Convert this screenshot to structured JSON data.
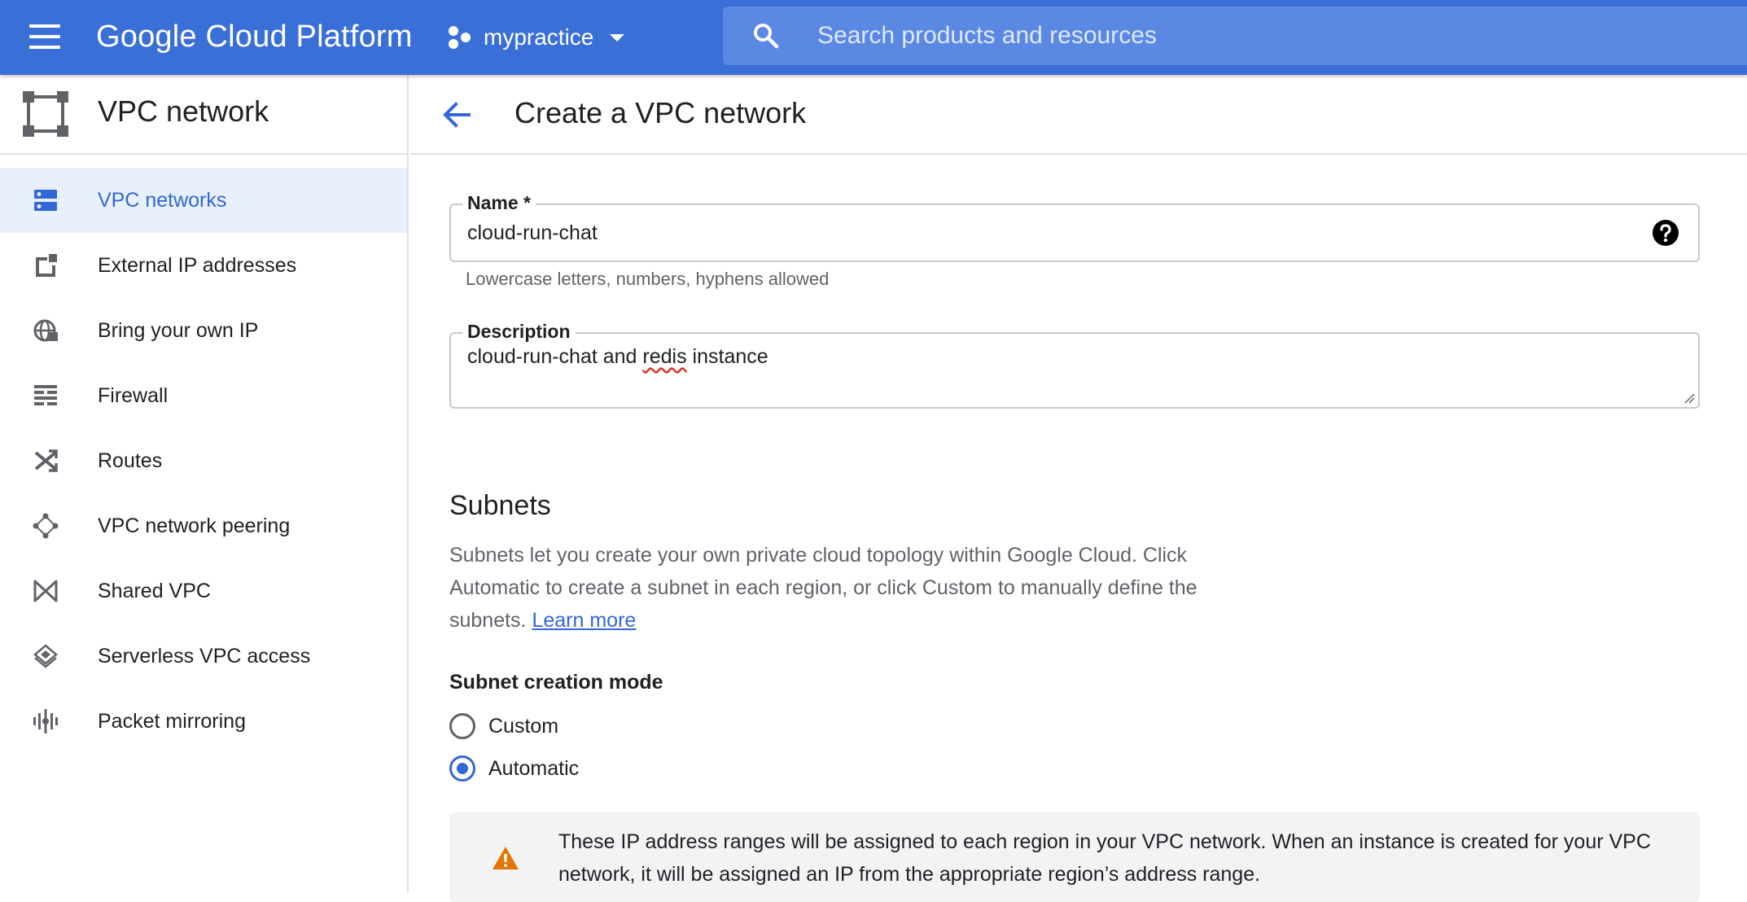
{
  "topbar": {
    "brand": "Google Cloud Platform",
    "project": "mypractice",
    "search_placeholder": "Search products and resources"
  },
  "sidebar": {
    "product_title": "VPC network",
    "items": [
      {
        "label": "VPC networks",
        "icon": "vpc-networks-icon",
        "active": true
      },
      {
        "label": "External IP addresses",
        "icon": "external-ip-icon",
        "active": false
      },
      {
        "label": "Bring your own IP",
        "icon": "globe-icon",
        "active": false
      },
      {
        "label": "Firewall",
        "icon": "firewall-icon",
        "active": false
      },
      {
        "label": "Routes",
        "icon": "routes-icon",
        "active": false
      },
      {
        "label": "VPC network peering",
        "icon": "peering-icon",
        "active": false
      },
      {
        "label": "Shared VPC",
        "icon": "shared-vpc-icon",
        "active": false
      },
      {
        "label": "Serverless VPC access",
        "icon": "serverless-icon",
        "active": false
      },
      {
        "label": "Packet mirroring",
        "icon": "packet-mirroring-icon",
        "active": false
      }
    ]
  },
  "page": {
    "title": "Create a VPC network",
    "name_field": {
      "label": "Name *",
      "value": "cloud-run-chat",
      "hint": "Lowercase letters, numbers, hyphens allowed"
    },
    "description_field": {
      "label": "Description",
      "value_before": "cloud-run-chat and ",
      "value_flagged": "redis",
      "value_after": " instance"
    },
    "subnets": {
      "title": "Subnets",
      "description": "Subnets let you create your own private cloud topology within Google Cloud. Click Automatic to create a subnet in each region, or click Custom to manually define the subnets.",
      "learn_more": "Learn more",
      "mode_label": "Subnet creation mode",
      "options": [
        {
          "label": "Custom",
          "selected": false
        },
        {
          "label": "Automatic",
          "selected": true
        }
      ],
      "notice": "These IP address ranges will be assigned to each region in your VPC network. When an instance is created for your VPC network, it will be assigned an IP from the appropriate region’s address range."
    }
  },
  "colors": {
    "topbar": "#3b6fd8",
    "accent": "#3367d6",
    "warning": "#e37400"
  }
}
